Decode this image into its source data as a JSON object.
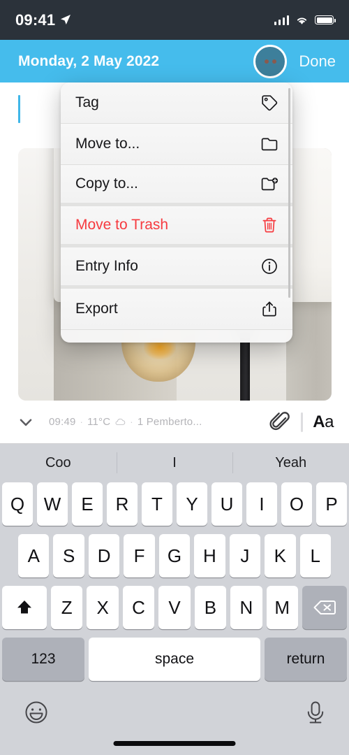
{
  "status_bar": {
    "time": "09:41",
    "location_icon": "location-arrow-icon",
    "signal_icon": "cellular-signal-icon",
    "wifi_icon": "wifi-icon",
    "battery_icon": "battery-full-icon"
  },
  "nav_bar": {
    "title": "Monday, 2 May 2022",
    "more_button_label": "•••",
    "done_label": "Done",
    "accent_color": "#45bcec"
  },
  "editor": {
    "caret_color": "#3fb6e8",
    "photo_alt": "lamp-with-filament-bulb-photo"
  },
  "action_menu": {
    "items": [
      {
        "label": "Tag",
        "icon": "tag-icon",
        "destructive": false
      },
      {
        "label": "Move to...",
        "icon": "folder-icon",
        "destructive": false
      },
      {
        "label": "Copy to...",
        "icon": "folder-plus-icon",
        "destructive": false
      },
      {
        "label": "Move to Trash",
        "icon": "trash-icon",
        "destructive": true
      },
      {
        "label": "Entry Info",
        "icon": "info-circle-icon",
        "destructive": false
      },
      {
        "label": "Export",
        "icon": "share-export-icon",
        "destructive": false
      }
    ],
    "danger_color": "#f63a3f"
  },
  "meta_bar": {
    "collapse_icon": "chevron-down-icon",
    "time": "09:49",
    "separator": "·",
    "temperature": "11°C",
    "weather_icon": "cloud-icon",
    "location": "1 Pemberto...",
    "attachment_icon": "paperclip-icon",
    "format_label_bold": "A",
    "format_label_small": "a"
  },
  "keyboard": {
    "suggestions": [
      "Coo",
      "I",
      "Yeah"
    ],
    "row1": [
      "Q",
      "W",
      "E",
      "R",
      "T",
      "Y",
      "U",
      "I",
      "O",
      "P"
    ],
    "row2": [
      "A",
      "S",
      "D",
      "F",
      "G",
      "H",
      "J",
      "K",
      "L"
    ],
    "row3_letters": [
      "Z",
      "X",
      "C",
      "V",
      "B",
      "N",
      "M"
    ],
    "shift_icon": "shift-up-arrow-icon",
    "delete_icon": "backspace-delete-icon",
    "numbers_label": "123",
    "space_label": "space",
    "return_label": "return",
    "emoji_icon": "emoji-smiley-icon",
    "dictation_icon": "microphone-icon",
    "background_color": "#d1d3d8"
  }
}
